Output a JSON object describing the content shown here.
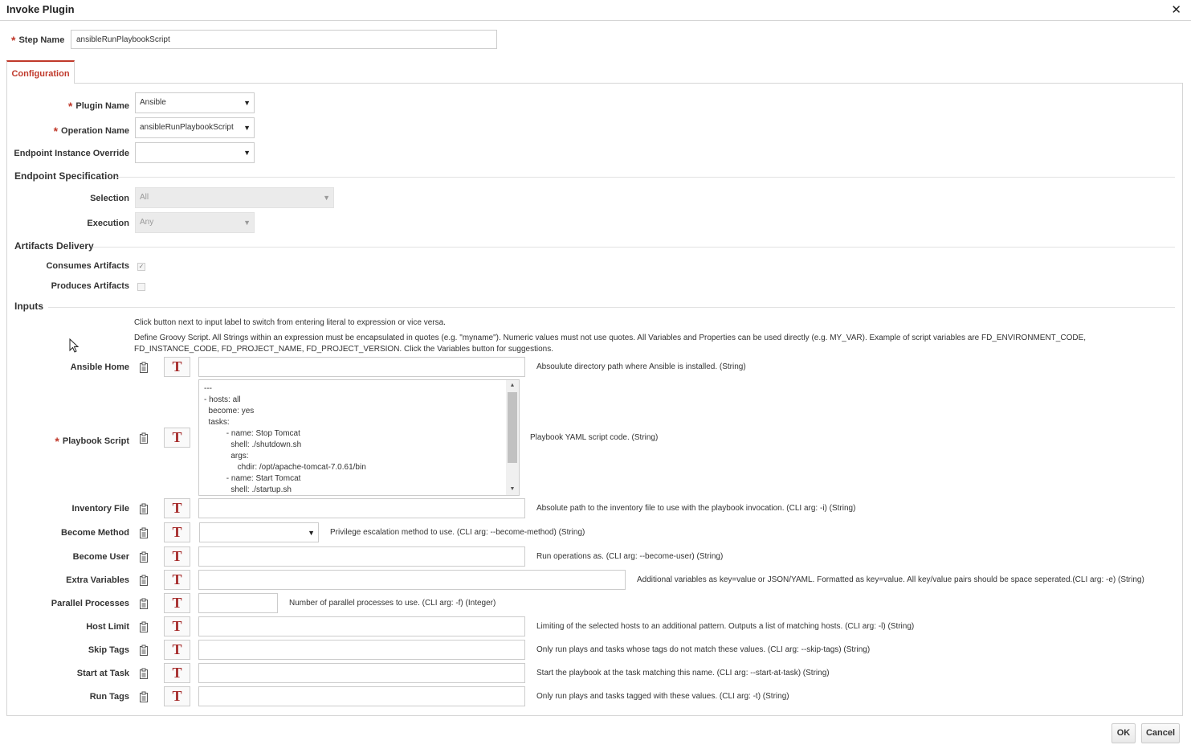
{
  "dialog": {
    "title": "Invoke Plugin",
    "close_glyph": "✕"
  },
  "step": {
    "label": "Step Name",
    "value": "ansibleRunPlaybookScript"
  },
  "tabs": [
    {
      "label": "Configuration",
      "active": true
    }
  ],
  "config": {
    "plugin_name": {
      "label": "Plugin Name",
      "value": "Ansible"
    },
    "operation_name": {
      "label": "Operation Name",
      "value": "ansibleRunPlaybookScript"
    },
    "endpoint_override": {
      "label": "Endpoint Instance Override",
      "value": ""
    }
  },
  "endpoint_spec": {
    "title": "Endpoint Specification",
    "selection": {
      "label": "Selection",
      "value": "All"
    },
    "execution": {
      "label": "Execution",
      "value": "Any"
    }
  },
  "artifacts": {
    "title": "Artifacts Delivery",
    "consumes": {
      "label": "Consumes Artifacts",
      "checked": true,
      "glyph": "✓"
    },
    "produces": {
      "label": "Produces Artifacts",
      "checked": false
    }
  },
  "inputs": {
    "title": "Inputs",
    "hint1": "Click button next to input label to switch from entering literal to expression or vice versa.",
    "hint2": "Define Groovy Script. All Strings within an expression must be encapsulated in quotes (e.g. \"myname\"). Numeric values must not use quotes. All Variables and Properties can be used directly (e.g. MY_VAR). Example of script variables are FD_ENVIRONMENT_CODE, FD_INSTANCE_CODE, FD_PROJECT_NAME, FD_PROJECT_VERSION. Click the Variables button for suggestions.",
    "toggle_glyph": "T",
    "fields": {
      "ansible_home": {
        "label": "Ansible Home",
        "value": "",
        "desc": "Absoulute directory path where Ansible is installed. (String)"
      },
      "playbook_script": {
        "label": "Playbook Script",
        "value": "---\n- hosts: all\n  become: yes\n  tasks:\n          - name: Stop Tomcat\n            shell: ./shutdown.sh\n            args:\n               chdir: /opt/apache-tomcat-7.0.61/bin\n          - name: Start Tomcat\n            shell: ./startup.sh",
        "desc": "Playbook YAML script code. (String)"
      },
      "inventory_file": {
        "label": "Inventory File",
        "value": "",
        "desc": "Absolute path to the inventory file to use with the playbook invocation. (CLI arg: -i) (String)"
      },
      "become_method": {
        "label": "Become Method",
        "value": "",
        "desc": "Privilege escalation method to use. (CLI arg: --become-method) (String)"
      },
      "become_user": {
        "label": "Become User",
        "value": "",
        "desc": "Run operations as. (CLI arg: --become-user) (String)"
      },
      "extra_variables": {
        "label": "Extra Variables",
        "value": "",
        "desc": "Additional variables as key=value or JSON/YAML. Formatted as key=value. All key/value pairs should be space seperated.(CLI arg: -e) (String)"
      },
      "parallel_processes": {
        "label": "Parallel Processes",
        "value": "",
        "desc": "Number of parallel processes to use. (CLI arg: -f) (Integer)"
      },
      "host_limit": {
        "label": "Host Limit",
        "value": "",
        "desc": "Limiting of the selected hosts to an additional pattern. Outputs a list of matching hosts. (CLI arg: -l) (String)"
      },
      "skip_tags": {
        "label": "Skip Tags",
        "value": "",
        "desc": "Only run plays and tasks whose tags do not match these values. (CLI arg: --skip-tags) (String)"
      },
      "start_at_task": {
        "label": "Start at Task",
        "value": "",
        "desc": "Start the playbook at the task matching this name. (CLI arg: --start-at-task) (String)"
      },
      "run_tags": {
        "label": "Run Tags",
        "value": "",
        "desc": "Only run plays and tasks tagged with these values. (CLI arg: -t) (String)"
      }
    }
  },
  "footer": {
    "ok_label": "OK",
    "cancel_label": "Cancel"
  },
  "colors": {
    "accent": "#c0392b",
    "toggle": "#a52a2a",
    "border": "#cccccc"
  }
}
